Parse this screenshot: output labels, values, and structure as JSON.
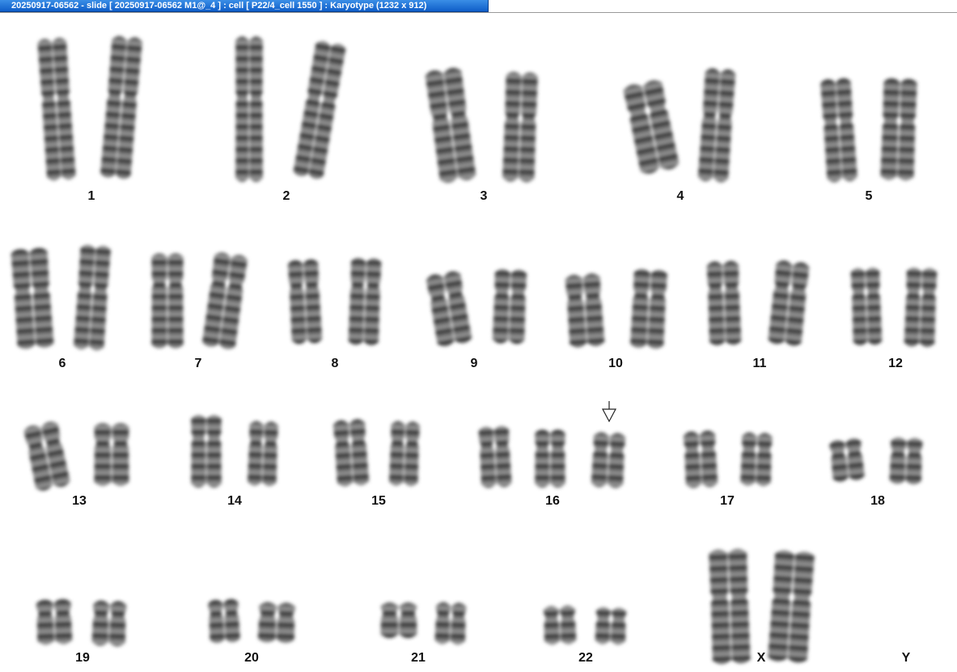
{
  "window": {
    "title": "20250917-06562 - slide [ 20250917-06562 M1@_4 ] : cell [ P22/4_cell 1550 ] : Karyotype  (1232 x 912)"
  },
  "karyotype": {
    "labels": {
      "c1": "1",
      "c2": "2",
      "c3": "3",
      "c4": "4",
      "c5": "5",
      "c6": "6",
      "c7": "7",
      "c8": "8",
      "c9": "9",
      "c10": "10",
      "c11": "11",
      "c12": "12",
      "c13": "13",
      "c14": "14",
      "c15": "15",
      "c16": "16",
      "c17": "17",
      "c18": "18",
      "c19": "19",
      "c20": "20",
      "c21": "21",
      "c22": "22",
      "cx": "X",
      "cy": "Y"
    },
    "marker": "arrow-down-icon"
  }
}
